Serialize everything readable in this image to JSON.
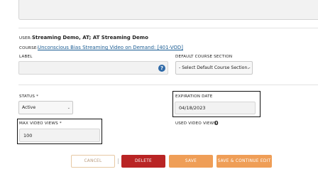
{
  "header": {
    "user_label": "USER:",
    "user_value": "Streaming Demo, AT; AT Streaming Demo",
    "course_label": "COURSE:",
    "course_link": "Unconscious Bias Streaming Video on Demand: [401-VOD]"
  },
  "form": {
    "label_field": {
      "label": "LABEL",
      "value": ""
    },
    "default_course_section": {
      "label": "DEFAULT COURSE SECTION",
      "selected": "- Select Default Course Section -"
    },
    "status": {
      "label": "STATUS *",
      "selected": "Active"
    },
    "expiration_date": {
      "label": "EXPIRATION DATE",
      "value": "04/18/2023"
    },
    "max_video_views": {
      "label": "MAX VIDEO VIEWS *",
      "value": "100"
    },
    "used_video_views": {
      "label": "USED VIDEO VIEWS:",
      "value": "0"
    }
  },
  "help_icon_glyph": "?",
  "icons": {
    "help": "help-circle-icon",
    "dropdown": "chevron-down-icon"
  },
  "chevron_glyph": "⌄",
  "actions": {
    "cancel": "CANCEL",
    "delete": "DELETE",
    "save": "SAVE",
    "save_continue": "SAVE & CONTINUE EDIT"
  },
  "colors": {
    "delete": "#b92424",
    "save": "#ef9e57",
    "link": "#1a5c93",
    "help_icon": "#2f6aa8"
  }
}
